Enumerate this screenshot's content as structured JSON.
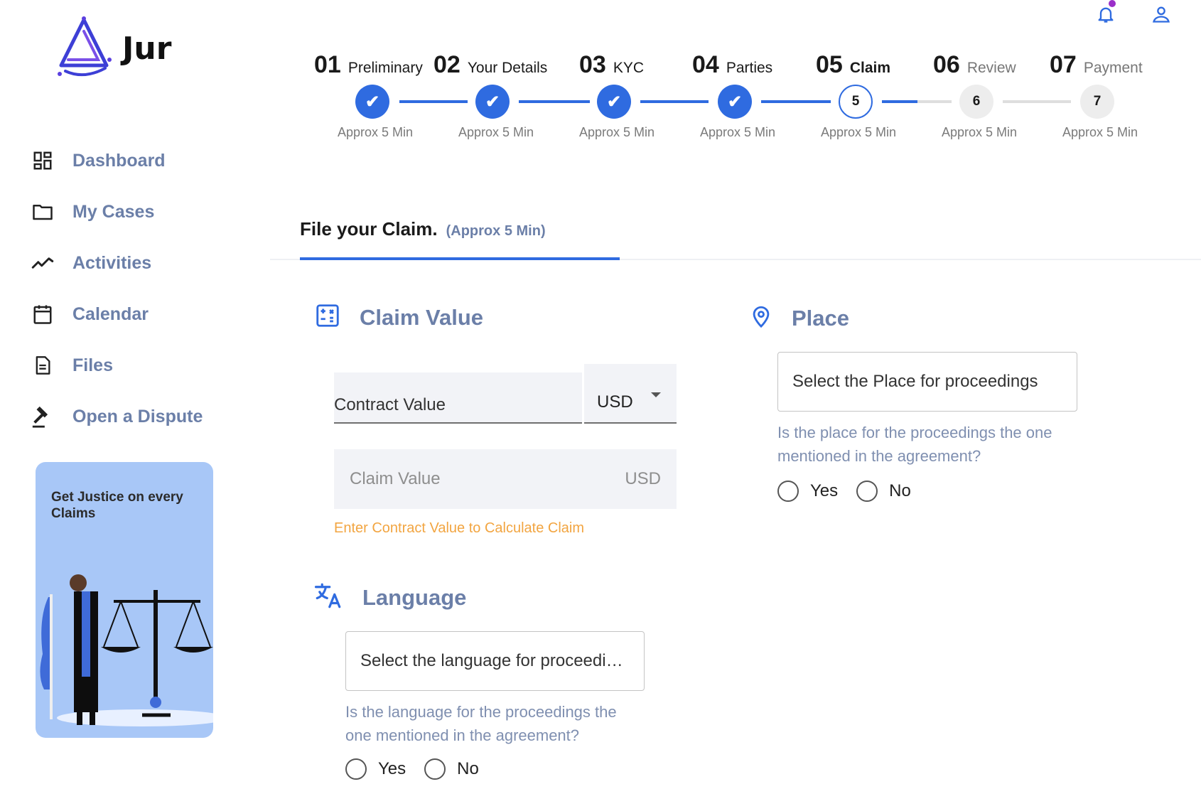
{
  "app": {
    "name": "Jur"
  },
  "sidebar": {
    "items": [
      {
        "label": "Dashboard",
        "icon": "dashboard-icon"
      },
      {
        "label": "My Cases",
        "icon": "folder-icon"
      },
      {
        "label": "Activities",
        "icon": "activity-icon"
      },
      {
        "label": "Calendar",
        "icon": "calendar-icon"
      },
      {
        "label": "Files",
        "icon": "file-icon"
      },
      {
        "label": "Open a Dispute",
        "icon": "gavel-icon"
      }
    ],
    "promo": {
      "text": "Get Justice on every Claims"
    }
  },
  "header": {
    "icons": [
      "bell-icon",
      "user-icon"
    ]
  },
  "stepper": {
    "steps": [
      {
        "num": "01",
        "name": "Preliminary",
        "marker": "✔",
        "status": "done",
        "time": "Approx 5 Min"
      },
      {
        "num": "02",
        "name": "Your Details",
        "marker": "✔",
        "status": "done",
        "time": "Approx 5 Min"
      },
      {
        "num": "03",
        "name": "KYC",
        "marker": "✔",
        "status": "done",
        "time": "Approx 5 Min"
      },
      {
        "num": "04",
        "name": "Parties",
        "marker": "✔",
        "status": "done",
        "time": "Approx 5 Min"
      },
      {
        "num": "05",
        "name": "Claim",
        "marker": "5",
        "status": "current",
        "time": "Approx 5 Min"
      },
      {
        "num": "06",
        "name": "Review",
        "marker": "6",
        "status": "todo",
        "time": "Approx 5 Min"
      },
      {
        "num": "07",
        "name": "Payment",
        "marker": "7",
        "status": "todo",
        "time": "Approx 5 Min"
      }
    ]
  },
  "form": {
    "title": "File your Claim.",
    "subtitle": "(Approx 5 Min)",
    "claim_value": {
      "heading": "Claim Value",
      "contract_label": "Contract Value",
      "currency": "USD",
      "claim_placeholder": "Claim Value",
      "claim_unit": "USD",
      "hint": "Enter Contract Value to Calculate Claim"
    },
    "language": {
      "heading": "Language",
      "placeholder": "Select the language for proceedings",
      "question": "Is the language for the proceedings the one mentioned in the agreement?",
      "yes": "Yes",
      "no": "No"
    },
    "place": {
      "heading": "Place",
      "placeholder": "Select the Place for proceedings",
      "question": "Is the place for the proceedings the one mentioned in the agreement?",
      "yes": "Yes",
      "no": "No"
    }
  },
  "colors": {
    "accent": "#2f6be0",
    "muted": "#6b7fa8",
    "warning": "#f2a541",
    "promo_bg": "#a8c7f7"
  }
}
